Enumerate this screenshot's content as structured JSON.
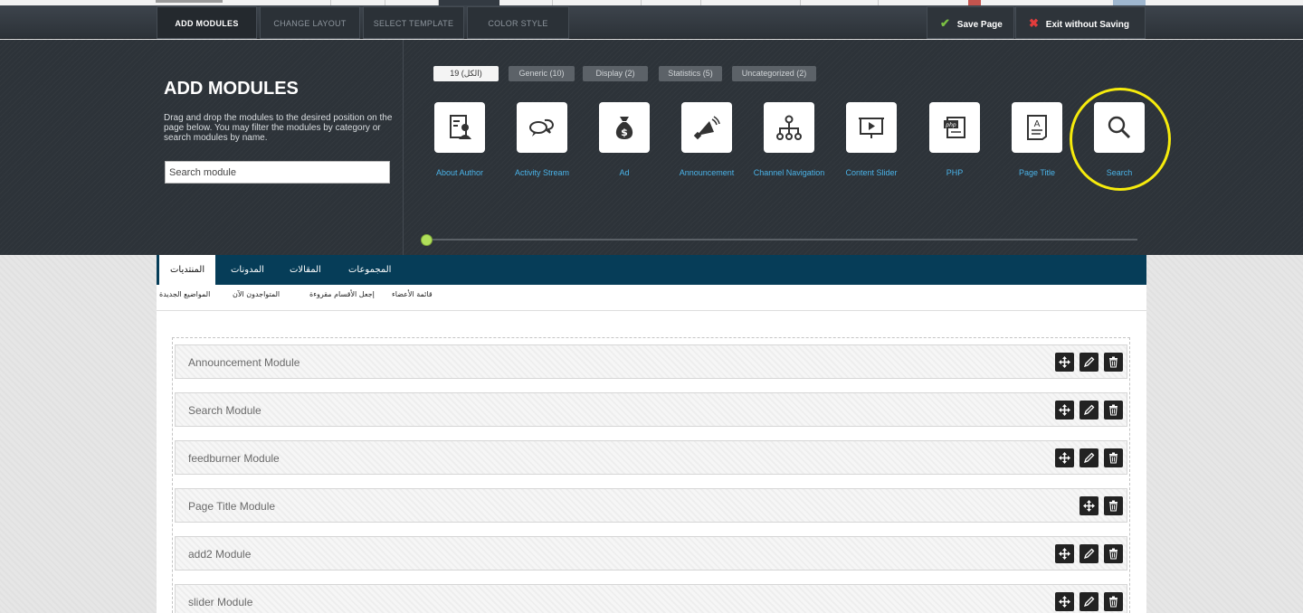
{
  "toolbar": {
    "tabs": [
      "ADD MODULES",
      "CHANGE LAYOUT",
      "SELECT TEMPLATE",
      "COLOR STYLE"
    ],
    "save_label": "Save Page",
    "exit_label": "Exit without Saving"
  },
  "panel": {
    "title": "ADD MODULES",
    "description": "Drag and drop the modules to the desired position on the page below. You may filter the modules by category or search modules by name.",
    "search_placeholder": "Search module",
    "filters": [
      "(الكل) 19",
      "Generic (10)",
      "Display (2)",
      "Statistics (5)",
      "Uncategorized (2)"
    ],
    "modules": [
      {
        "label": "About Author",
        "icon": "about-author-icon"
      },
      {
        "label": "Activity Stream",
        "icon": "activity-stream-icon"
      },
      {
        "label": "Ad",
        "icon": "ad-money-bag-icon"
      },
      {
        "label": "Announcement",
        "icon": "announcement-megaphone-icon"
      },
      {
        "label": "Channel Navigation",
        "icon": "channel-navigation-icon"
      },
      {
        "label": "Content Slider",
        "icon": "content-slider-icon"
      },
      {
        "label": "PHP",
        "icon": "php-icon"
      },
      {
        "label": "Page Title",
        "icon": "page-title-icon"
      },
      {
        "label": "Search",
        "icon": "search-icon"
      }
    ],
    "colors": {
      "accent": "#4ab3e8",
      "highlight": "#f6eb0c",
      "slider": "#b0e05a"
    }
  },
  "page": {
    "nav": [
      "المنتديات",
      "المدونات",
      "المقالات",
      "المجموعات"
    ],
    "subnav": [
      "المواضيع الجديدة",
      "المتواجدون الآن",
      "إجعل الأقسام مقروءة",
      "قائمة الأعضاء"
    ],
    "rows": [
      {
        "name": "Announcement Module",
        "editable": true
      },
      {
        "name": "Search Module",
        "editable": true
      },
      {
        "name": "feedburner Module",
        "editable": true
      },
      {
        "name": "Page Title Module",
        "editable": false
      },
      {
        "name": "add2 Module",
        "editable": true
      },
      {
        "name": "slider Module",
        "editable": true
      }
    ]
  }
}
